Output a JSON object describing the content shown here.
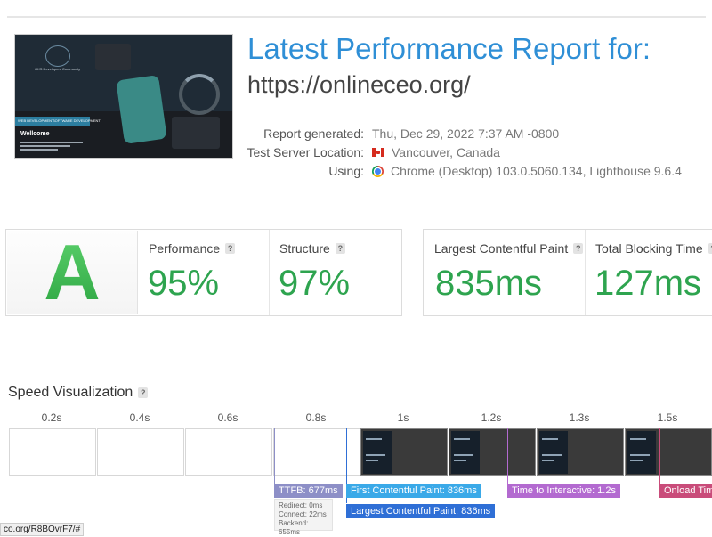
{
  "report": {
    "title": "Latest Performance Report for:",
    "url": "https://onlineceo.org/",
    "generated_label": "Report generated:",
    "generated_value": "Thu, Dec 29, 2022 7:37 AM -0800",
    "location_label": "Test Server Location:",
    "location_value": "Vancouver, Canada",
    "using_label": "Using:",
    "using_value": "Chrome (Desktop) 103.0.5060.134, Lighthouse 9.6.4"
  },
  "thumbnail": {
    "org": "OKS Developers Community",
    "tab1": "WEB DEVELOPMENT",
    "tab2": "SOFTWARE DEVELOPMENT",
    "heading": "Wellcome"
  },
  "scores": {
    "grade": "A",
    "performance_label": "Performance",
    "performance_value": "95%",
    "structure_label": "Structure",
    "structure_value": "97%",
    "lcp_label": "Largest Contentful Paint",
    "lcp_value": "835ms",
    "tbt_label": "Total Blocking Time",
    "tbt_value": "127ms",
    "help_icon": "?"
  },
  "speed": {
    "title": "Speed Visualization",
    "ticks": [
      "0.2s",
      "0.4s",
      "0.6s",
      "0.8s",
      "1s",
      "1.2s",
      "1.3s",
      "1.5s"
    ],
    "markers": {
      "ttfb": "TTFB: 677ms",
      "fcp": "First Contentful Paint: 836ms",
      "lcp": "Largest Contentful Paint: 836ms",
      "tti": "Time to Interactive: 1.2s",
      "onload": "Onload Time"
    },
    "ttfb_detail": {
      "redirect": "Redirect: 0ms",
      "connect": "Connect: 22ms",
      "backend": "Backend: 655ms"
    },
    "colors": {
      "ttfb": "#8d8fc7",
      "fcp": "#3aa9e8",
      "lcp": "#2f6fd6",
      "tti": "#b36ad0",
      "onload": "#c94c7a"
    }
  },
  "status_bar": {
    "url": "co.org/R8BOvrF7/#"
  }
}
